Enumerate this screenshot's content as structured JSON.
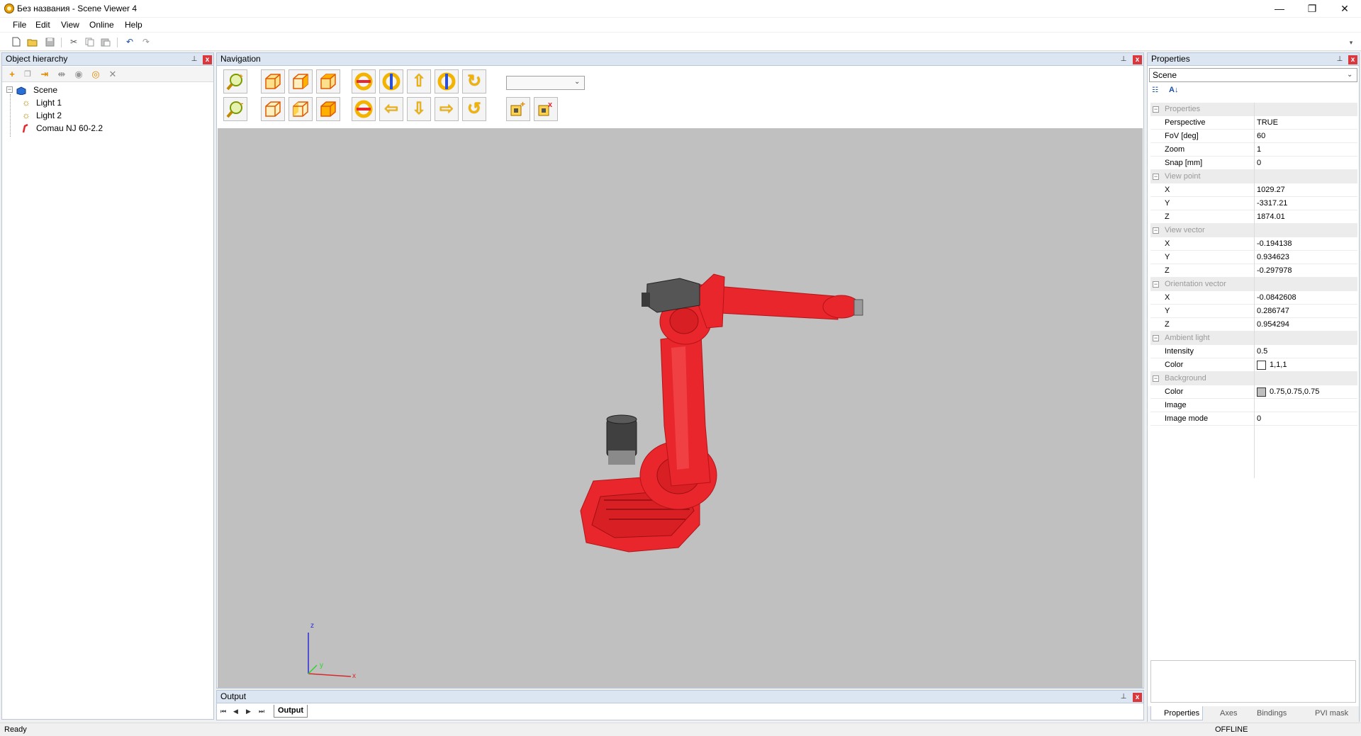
{
  "window": {
    "title": "Без названия - Scene Viewer 4",
    "minimize": "—",
    "maximize": "❐",
    "close": "✕"
  },
  "menu": [
    "File",
    "Edit",
    "View",
    "Online",
    "Help"
  ],
  "hierarchy": {
    "title": "Object hierarchy",
    "pin": "📌",
    "close": "x",
    "tree": {
      "root": "Scene",
      "children": [
        "Light 1",
        "Light 2",
        "Comau NJ 60-2.2"
      ]
    }
  },
  "navigation": {
    "title": "Navigation",
    "view_select": "",
    "axes": {
      "z": "z",
      "y": "y",
      "x": "x"
    }
  },
  "output": {
    "title": "Output",
    "tab": "Output",
    "first": "⏮",
    "prev": "◀",
    "next": "▶",
    "last": "⏭"
  },
  "properties": {
    "title": "Properties",
    "selected": "Scene",
    "categories": [
      {
        "name": "Properties",
        "rows": [
          {
            "name": "Perspective",
            "value": "TRUE"
          },
          {
            "name": "FoV [deg]",
            "value": "60"
          },
          {
            "name": "Zoom",
            "value": "1"
          },
          {
            "name": "Snap [mm]",
            "value": "0"
          }
        ]
      },
      {
        "name": "View point",
        "rows": [
          {
            "name": "X",
            "value": "1029.27"
          },
          {
            "name": "Y",
            "value": "-3317.21"
          },
          {
            "name": "Z",
            "value": "1874.01"
          }
        ]
      },
      {
        "name": "View vector",
        "rows": [
          {
            "name": "X",
            "value": "-0.194138"
          },
          {
            "name": "Y",
            "value": "0.934623"
          },
          {
            "name": "Z",
            "value": "-0.297978"
          }
        ]
      },
      {
        "name": "Orientation vector",
        "rows": [
          {
            "name": "X",
            "value": "-0.0842608"
          },
          {
            "name": "Y",
            "value": "0.286747"
          },
          {
            "name": "Z",
            "value": "0.954294"
          }
        ]
      },
      {
        "name": "Ambient light",
        "rows": [
          {
            "name": "Intensity",
            "value": "0.5"
          },
          {
            "name": "Color",
            "value": "1,1,1",
            "swatch": "#ffffff"
          }
        ]
      },
      {
        "name": "Background",
        "rows": [
          {
            "name": "Color",
            "value": "0.75,0.75,0.75",
            "swatch": "#bfbfbf"
          },
          {
            "name": "Image",
            "value": ""
          },
          {
            "name": "Image mode",
            "value": "0"
          }
        ]
      }
    ],
    "tabs": [
      "Properties",
      "Axes",
      "Bindings",
      "PVI mask"
    ]
  },
  "status": {
    "left": "Ready",
    "right": "OFFLINE"
  },
  "colors": {
    "robot": "#e8262b",
    "viewport_bg": "#c0c0c0",
    "panel_header": "#dce6f2"
  }
}
